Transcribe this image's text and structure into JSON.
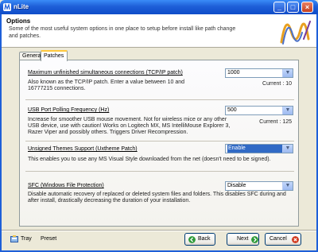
{
  "window": {
    "title": "nLite"
  },
  "header": {
    "title": "Options",
    "description": "Some of the most useful system options in one place to setup before install like path change and patches."
  },
  "tabs": [
    {
      "label": "General"
    },
    {
      "label": "Patches"
    }
  ],
  "options": [
    {
      "label": "Maximum unfinished simultaneous connections (TCP/IP patch)",
      "value": "1000",
      "description": "Also known as the TCP/IP patch. Enter a value between 10 and 16777215 connections.",
      "current": "Current : 10"
    },
    {
      "label": "USB Port Polling Frequency (Hz)",
      "value": "500",
      "description": "Increase for smoother USB mouse movement. Not for wireless mice or any other USB device, use with caution! Works on Logitech MX, MS IntelliMouse Explorer 3, Razer Viper and possibly others. Triggers Driver Recompression.",
      "current": "Current : 125"
    },
    {
      "label": "Unsigned Themes Support (Uxtheme Patch)",
      "value": "Enable",
      "description": "This enables you to use any MS Visual Style downloaded from the net (doesn't need to be signed)."
    },
    {
      "label": "SFC (Windows File Protection)",
      "value": "Disable",
      "description": "Disable automatic recovery of replaced or deleted system files and folders. This disables SFC during and after install, drastically decreasing the duration of your installation."
    }
  ],
  "footer": {
    "tray": "Tray",
    "preset": "Preset",
    "back": "Back",
    "next": "Next",
    "cancel": "Cancel"
  },
  "colors": {
    "titlebar": "#1E5FD8",
    "accent_tab": "#FFC83C",
    "selection": "#316AC5",
    "back_icon": "#2E9B3A",
    "next_icon": "#2E9B3A",
    "cancel_icon": "#D23A1F"
  }
}
